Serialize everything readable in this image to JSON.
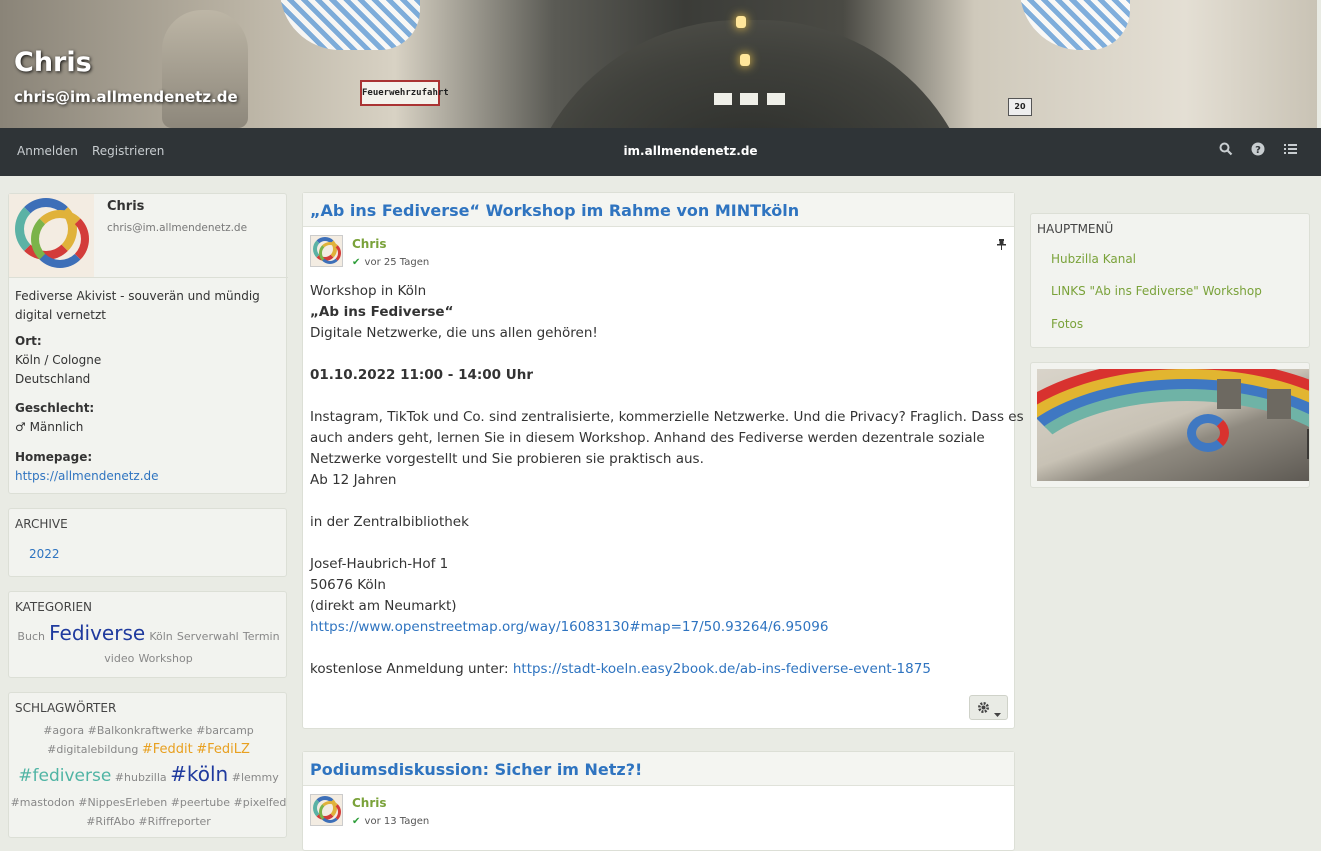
{
  "cover": {
    "name": "Chris",
    "address": "chris@im.allmendenetz.de",
    "sign_text": "Feuerwehrzufahrt",
    "plate_text": "20"
  },
  "navbar": {
    "login": "Anmelden",
    "register": "Registrieren",
    "brand": "im.allmendenetz.de",
    "icons": [
      "search-icon",
      "help-icon",
      "menu-icon"
    ]
  },
  "profile": {
    "name": "Chris",
    "address": "chris@im.allmendenetz.de",
    "bio": [
      "Fediverse Akivist - souverän und mündig",
      "digital vernetzt"
    ],
    "location_label": "Ort:",
    "location": [
      "Köln / Cologne",
      "Deutschland"
    ],
    "gender_label": "Geschlecht:",
    "gender": "♂ Männlich",
    "homepage_label": "Homepage:",
    "homepage": "https://allmendenetz.de"
  },
  "archive": {
    "title": "ARCHIVE",
    "items": [
      "2022"
    ]
  },
  "categories": {
    "title": "KATEGORIEN",
    "items": [
      "Buch",
      "Fediverse",
      "Köln",
      "Serverwahl",
      "Termin",
      "video",
      "Workshop"
    ]
  },
  "tags": {
    "title": "SCHLAGWÖRTER",
    "items": [
      "#agora",
      "#Balkonkraftwerke",
      "#barcamp",
      "#digitalebildung",
      "#Feddit",
      "#FediLZ",
      "#fediverse",
      "#hubzilla",
      "#köln",
      "#lemmy",
      "#mastodon",
      "#NippesErleben",
      "#peertube",
      "#pixelfed",
      "#RiffAbo",
      "#Riffreporter"
    ]
  },
  "post1": {
    "title": "„Ab ins Fediverse“ Workshop im Rahme von MINTköln",
    "author": "Chris",
    "ago": "vor 25 Tagen",
    "lines": [
      "Workshop in Köln",
      "„Ab ins Fediverse“",
      "Digitale Netzwerke, die uns allen gehören!",
      "01.10.2022 11:00 - 14:00 Uhr",
      "Instagram, TikTok und Co. sind zentralisierte, kommerzielle Netzwerke. Und die Privacy? Fraglich. Dass es",
      "auch anders geht, lernen Sie in diesem Workshop. Anhand des Fediverse werden dezentrale soziale",
      "Netzwerke vorgestellt und Sie probieren sie praktisch aus.",
      "Ab 12 Jahren",
      "in der Zentralbibliothek",
      "Josef-Haubrich-Hof 1",
      "50676 Köln",
      "(direkt am Neumarkt)",
      "https://www.openstreetmap.org/way/16083130#map=17/50.93264/6.95096",
      "kostenlose Anmeldung unter: ",
      "https://stadt-koeln.easy2book.de/ab-ins-fediverse-event-1875"
    ]
  },
  "post2": {
    "title": "Podiumsdiskussion: Sicher im Netz?!",
    "author": "Chris",
    "ago": "vor 13 Tagen"
  },
  "mainmenu": {
    "title": "HAUPTMENÜ",
    "items": [
      "Hubzilla Kanal",
      "LINKS \"Ab ins Fediverse\" Workshop",
      "Fotos"
    ]
  },
  "colors": {
    "navbar": "#2f3437",
    "link": "#2f74c0",
    "author_green": "#7aa23a",
    "tag_large_blue": "#1f3a9e",
    "tag_orange": "#e8a020",
    "tag_teal": "#4fb4a4"
  }
}
